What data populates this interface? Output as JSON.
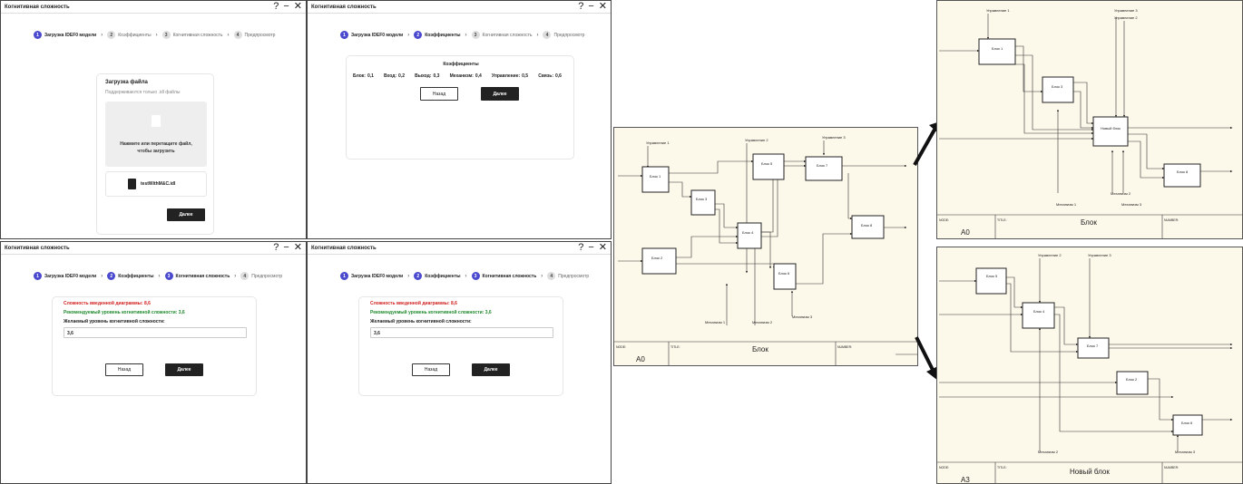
{
  "window_title": "Когнитивная сложность",
  "controls": {
    "help": "?",
    "minimize": "−",
    "close": "✕"
  },
  "steps": [
    {
      "num": "1",
      "label": "Загрузка IDEF0 модели"
    },
    {
      "num": "2",
      "label": "Коэффициенты"
    },
    {
      "num": "3",
      "label": "Когнитивная сложность"
    },
    {
      "num": "4",
      "label": "Предпросмотр"
    }
  ],
  "step_sep": "›",
  "upload": {
    "title": "Загрузка файла",
    "subtitle": "Поддерживаются только .idl файлы",
    "drop_text_1": "Нажмите или перетащите файл,",
    "drop_text_2": "чтобы загрузить",
    "file_name": "testWithM&C.idl"
  },
  "coefficients": {
    "title": "Коэффициенты",
    "items": [
      {
        "label": "Блок:",
        "value": "0,1"
      },
      {
        "label": "Вход:",
        "value": "0,2"
      },
      {
        "label": "Выход:",
        "value": "0,3"
      },
      {
        "label": "Механизм:",
        "value": "0,4"
      },
      {
        "label": "Управление:",
        "value": "0,5"
      },
      {
        "label": "Связь:",
        "value": "0,6"
      }
    ]
  },
  "complexity": {
    "diagram_complexity": "Сложность введенной диаграммы: 8,6",
    "recommended": "Рекомендуемый уровень когнитивной сложности: 3,6",
    "desired_label": "Желаемый уровень когнитивной сложности:",
    "desired_value": "3,6"
  },
  "buttons": {
    "next": "Далее",
    "back": "Назад"
  },
  "diagram_main": {
    "blocks": [
      "Блок 1",
      "Блок 2",
      "Блок 3",
      "Блок 4",
      "Блок 5",
      "Блок 6",
      "Блок 7",
      "Блок 8"
    ],
    "controls": [
      "Управление 1",
      "Управление 2",
      "Управление 3"
    ],
    "mechanisms": [
      "Механизм 1",
      "Механизм 2",
      "Механизм 3"
    ],
    "footer": {
      "node_label": "NODE:",
      "node": "A0",
      "title_label": "TITLE:",
      "title": "Блок",
      "number_label": "NUMBER:"
    }
  },
  "diagram_a0": {
    "blocks": [
      "Блок 1",
      "Блок 3",
      "Новый блок",
      "Блок 8"
    ],
    "controls": [
      "Управление 1",
      "Управление 3",
      "Управление 2"
    ],
    "mechanisms": [
      "Механизм 1",
      "Механизм 2",
      "Механизм 3"
    ],
    "footer": {
      "node_label": "NODE:",
      "node": "A0",
      "title_label": "TITLE:",
      "title": "Блок",
      "number_label": "NUMBER:"
    }
  },
  "diagram_a3": {
    "blocks": [
      "Блок 5",
      "Блок 4",
      "Блок 7",
      "Блок 2",
      "Блок 6"
    ],
    "controls": [
      "Управление 2",
      "Управление 3"
    ],
    "mechanisms": [
      "Механизм 2",
      "Механизм 3"
    ],
    "footer": {
      "node_label": "NODE:",
      "node": "A3",
      "title_label": "TITLE:",
      "title": "Новый блок",
      "number_label": "NUMBER:"
    }
  }
}
